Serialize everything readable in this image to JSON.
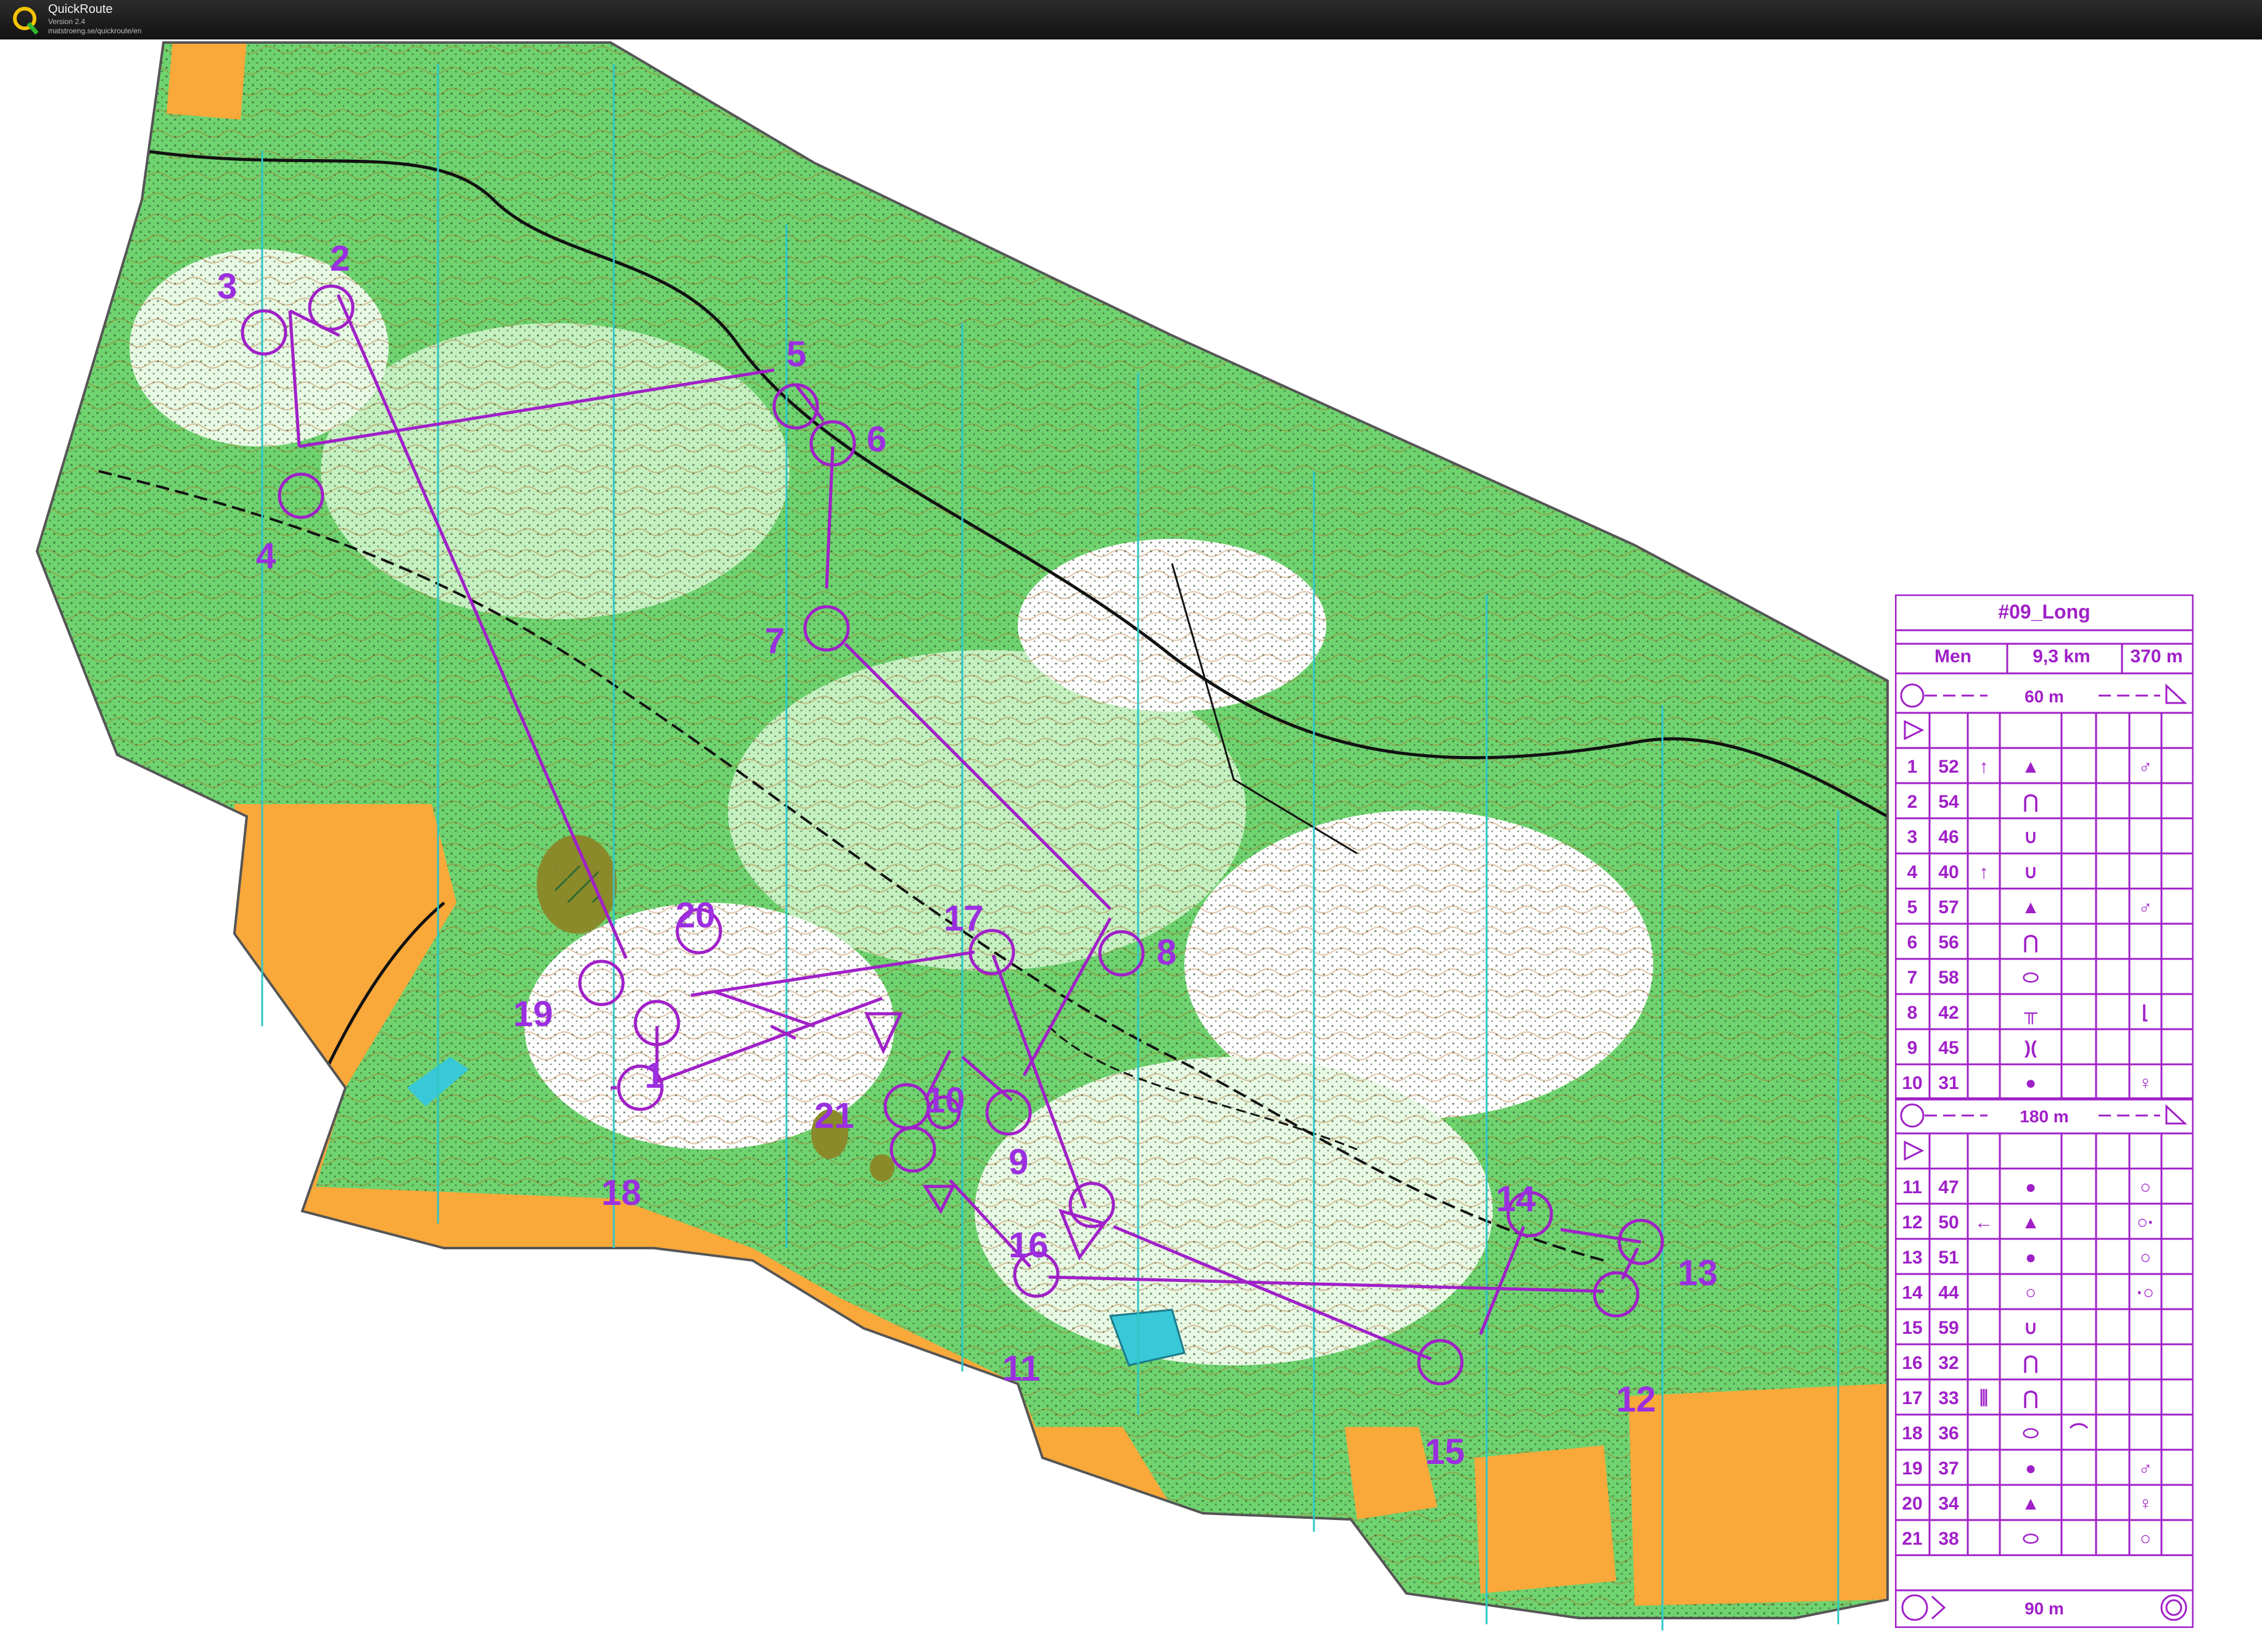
{
  "app": {
    "title": "QuickRoute",
    "version": "Version 2.4",
    "url": "matstroeng.se/quickroute/en"
  },
  "colors": {
    "course": "#a020c8",
    "forest_green": "#6fd36f",
    "open_land": "#f9a83a",
    "water": "#38c8d8",
    "contours": "#b5651d"
  },
  "course": {
    "name": "#09_Long",
    "class": "Men",
    "length": "9,3 km",
    "climb": "370 m",
    "leg_labels": {
      "start_to_first": "60 m",
      "middle_marked": "180 m",
      "finish": "90 m"
    },
    "controls": [
      {
        "n": "1",
        "code": "52",
        "c": "↑",
        "d": "▲",
        "g": "",
        "h": "♂"
      },
      {
        "n": "2",
        "code": "54",
        "c": "",
        "d": "⋂",
        "g": "",
        "h": ""
      },
      {
        "n": "3",
        "code": "46",
        "c": "",
        "d": "∪",
        "g": "",
        "h": ""
      },
      {
        "n": "4",
        "code": "40",
        "c": "↑",
        "d": "∪",
        "g": "",
        "h": ""
      },
      {
        "n": "5",
        "code": "57",
        "c": "",
        "d": "▲",
        "g": "",
        "h": "♂"
      },
      {
        "n": "6",
        "code": "56",
        "c": "",
        "d": "⋂",
        "g": "",
        "h": ""
      },
      {
        "n": "7",
        "code": "58",
        "c": "",
        "d": "⬭",
        "g": "",
        "h": ""
      },
      {
        "n": "8",
        "code": "42",
        "c": "",
        "d": "╥",
        "g": "",
        "h": "⌊"
      },
      {
        "n": "9",
        "code": "45",
        "c": "",
        "d": ")(",
        "g": "",
        "h": ""
      },
      {
        "n": "10",
        "code": "31",
        "c": "",
        "d": "●",
        "g": "",
        "h": "♀"
      },
      {
        "n": "11",
        "code": "47",
        "c": "",
        "d": "●",
        "g": "",
        "h": "○"
      },
      {
        "n": "12",
        "code": "50",
        "c": "←",
        "d": "▲",
        "g": "",
        "h": "○·"
      },
      {
        "n": "13",
        "code": "51",
        "c": "",
        "d": "●",
        "g": "",
        "h": "○"
      },
      {
        "n": "14",
        "code": "44",
        "c": "",
        "d": "○",
        "g": "",
        "h": "·○"
      },
      {
        "n": "15",
        "code": "59",
        "c": "",
        "d": "∪",
        "g": "",
        "h": ""
      },
      {
        "n": "16",
        "code": "32",
        "c": "",
        "d": "⋂",
        "g": "",
        "h": ""
      },
      {
        "n": "17",
        "code": "33",
        "c": "⫼",
        "d": "⋂",
        "g": "",
        "h": ""
      },
      {
        "n": "18",
        "code": "36",
        "c": "",
        "d": "⬭",
        "g": "⌒",
        "h": ""
      },
      {
        "n": "19",
        "code": "37",
        "c": "",
        "d": "●",
        "g": "",
        "h": "♂"
      },
      {
        "n": "20",
        "code": "34",
        "c": "",
        "d": "▲",
        "g": "",
        "h": "♀"
      },
      {
        "n": "21",
        "code": "38",
        "c": "",
        "d": "⬭",
        "g": "",
        "h": "○"
      }
    ]
  },
  "map_control_labels": [
    "1",
    "2",
    "3",
    "4",
    "5",
    "6",
    "7",
    "8",
    "9",
    "10",
    "11",
    "12",
    "13",
    "14",
    "15",
    "16",
    "17",
    "18",
    "19",
    "20",
    "21"
  ]
}
